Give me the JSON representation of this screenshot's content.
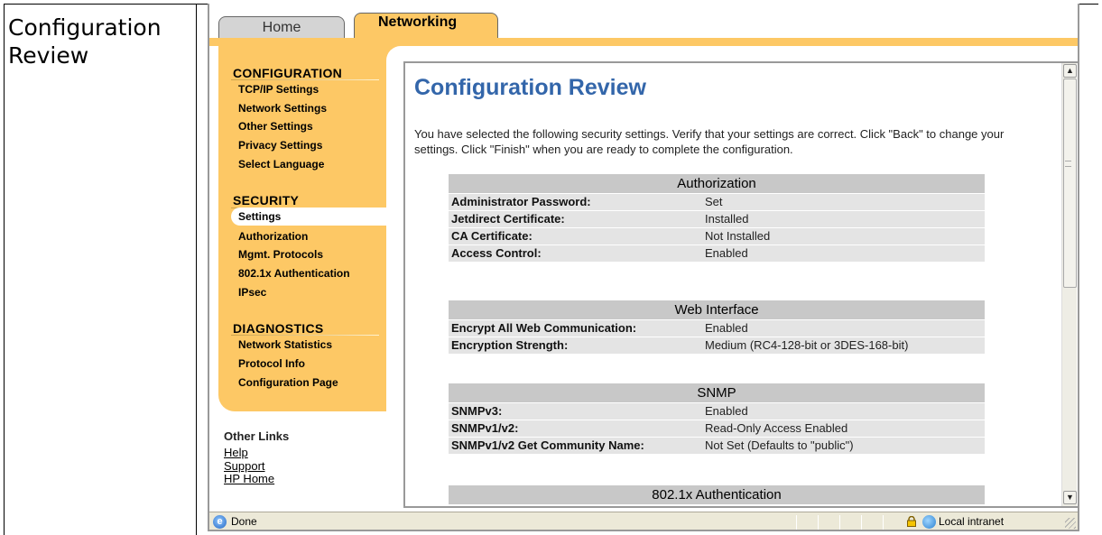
{
  "doc": {
    "label": "Configuration Review"
  },
  "tabs": {
    "home": "Home",
    "networking": "Networking"
  },
  "sidebar": {
    "configuration": {
      "title": "CONFIGURATION",
      "items": [
        "TCP/IP Settings",
        "Network Settings",
        "Other Settings",
        "Privacy Settings",
        "Select Language"
      ]
    },
    "security": {
      "title": "SECURITY",
      "selected": "Settings",
      "items": [
        "Authorization",
        "Mgmt. Protocols",
        "802.1x Authentication",
        "IPsec"
      ]
    },
    "diagnostics": {
      "title": "DIAGNOSTICS",
      "items": [
        "Network Statistics",
        "Protocol Info",
        "Configuration Page"
      ]
    },
    "other_links": {
      "title": "Other Links",
      "links": [
        "Help",
        "Support",
        "HP Home"
      ]
    }
  },
  "main": {
    "title": "Configuration Review",
    "intro": "You have selected the following security settings. Verify that your settings are correct. Click \"Back\" to change your settings. Click \"Finish\" when you are ready to complete the configuration.",
    "sections": [
      {
        "title": "Authorization",
        "rows": [
          {
            "k": "Administrator Password:",
            "v": "Set"
          },
          {
            "k": "Jetdirect Certificate:",
            "v": "Installed"
          },
          {
            "k": "CA Certificate:",
            "v": "Not Installed"
          },
          {
            "k": "Access Control:",
            "v": "Enabled"
          }
        ]
      },
      {
        "title": "Web Interface",
        "rows": [
          {
            "k": "Encrypt All Web Communication:",
            "v": "Enabled"
          },
          {
            "k": "Encryption Strength:",
            "v": "Medium (RC4-128-bit or 3DES-168-bit)"
          }
        ]
      },
      {
        "title": "SNMP",
        "rows": [
          {
            "k": "SNMPv3:",
            "v": "Enabled"
          },
          {
            "k": "SNMPv1/v2:",
            "v": "Read-Only Access Enabled"
          },
          {
            "k": "SNMPv1/v2 Get Community Name:",
            "v": "Not Set (Defaults to \"public\")"
          }
        ]
      },
      {
        "title": "802.1x Authentication",
        "rows": []
      }
    ]
  },
  "statusbar": {
    "status": "Done",
    "zone": "Local intranet"
  },
  "colors": {
    "sidebar": "#fdc865",
    "title": "#3366aa",
    "section_head": "#c8c8c8",
    "row": "#e4e4e4"
  }
}
